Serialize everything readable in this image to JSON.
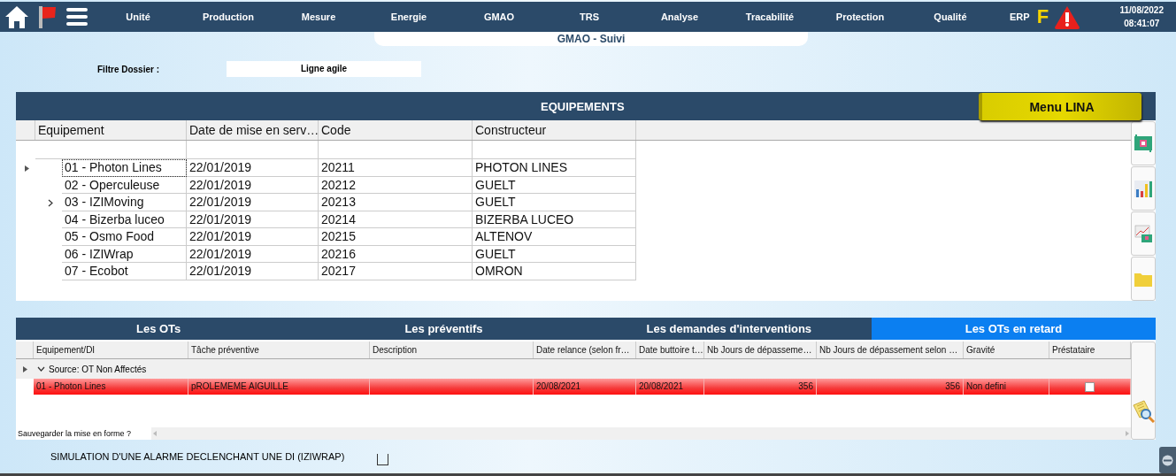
{
  "nav": {
    "items": [
      "Unité",
      "Production",
      "Mesure",
      "Energie",
      "GMAO",
      "TRS",
      "Analyse",
      "Tracabilité",
      "Protection",
      "Qualité"
    ],
    "erp": "ERP",
    "flag_letter": "F",
    "date": "11/08/2022",
    "time": "08:41:07"
  },
  "subtitle": "GMAO - Suivi",
  "filter": {
    "label": "Filtre Dossier :",
    "value": "Ligne agile"
  },
  "equipements": {
    "title": "EQUIPEMENTS",
    "menu_button": "Menu LINA",
    "columns": [
      "Equipement",
      "Date de mise en serv…",
      "Code",
      "Constructeur"
    ],
    "rows": [
      {
        "current": true,
        "expandable": false,
        "cells": [
          "01 - Photon Lines",
          "22/01/2019",
          "20211",
          "PHOTON LINES"
        ]
      },
      {
        "current": false,
        "expandable": false,
        "cells": [
          "02 - Operculeuse",
          "22/01/2019",
          "20212",
          "GUELT"
        ]
      },
      {
        "current": false,
        "expandable": true,
        "cells": [
          "03 - IZIMoving",
          "22/01/2019",
          "20213",
          "GUELT"
        ]
      },
      {
        "current": false,
        "expandable": false,
        "cells": [
          "04 - Bizerba luceo",
          "22/01/2019",
          "20214",
          "BIZERBA LUCEO"
        ]
      },
      {
        "current": false,
        "expandable": false,
        "cells": [
          "05 - Osmo Food",
          "22/01/2019",
          "20215",
          "ALTENOV"
        ]
      },
      {
        "current": false,
        "expandable": false,
        "cells": [
          "06 - IZIWrap",
          "22/01/2019",
          "20216",
          "GUELT"
        ]
      },
      {
        "current": false,
        "expandable": false,
        "cells": [
          "07 - Ecobot",
          "22/01/2019",
          "20217",
          "OMRON"
        ]
      }
    ]
  },
  "ots": {
    "tabs": [
      {
        "label": "Les OTs",
        "selected": false
      },
      {
        "label": "Les préventifs",
        "selected": false
      },
      {
        "label": "Les demandes d'interventions",
        "selected": false
      },
      {
        "label": "Les OTs en retard",
        "selected": true
      }
    ],
    "columns": [
      {
        "label": "Equipement/DI",
        "kind": "text"
      },
      {
        "label": "Tâche préventive",
        "kind": "text"
      },
      {
        "label": "Description",
        "kind": "text"
      },
      {
        "label": "Date relance (selon fr…",
        "kind": "text"
      },
      {
        "label": "Date buttoire t…",
        "kind": "text"
      },
      {
        "label": "Nb Jours de dépasseme…",
        "kind": "number"
      },
      {
        "label": "Nb Jours de dépassement selon …",
        "kind": "number"
      },
      {
        "label": "Gravité",
        "kind": "text"
      },
      {
        "label": "Préstataire",
        "kind": "check"
      }
    ],
    "group": {
      "label": "Source: OT Non Affectés",
      "expanded": true,
      "current": true
    },
    "rows": [
      {
        "overdue": true,
        "checked": false,
        "cells": [
          "01 - Photon Lines",
          "pROLEMEME AIGUILLE",
          "",
          "20/08/2021",
          "20/08/2021",
          "356",
          "356",
          "Non defini"
        ]
      }
    ],
    "footer": "Sauvegarder la mise en forme ?"
  },
  "simulation": {
    "label": "SIMULATION D'UNE ALARME DECLENCHANT UNE DI (IZIWRAP)",
    "checked": false
  }
}
